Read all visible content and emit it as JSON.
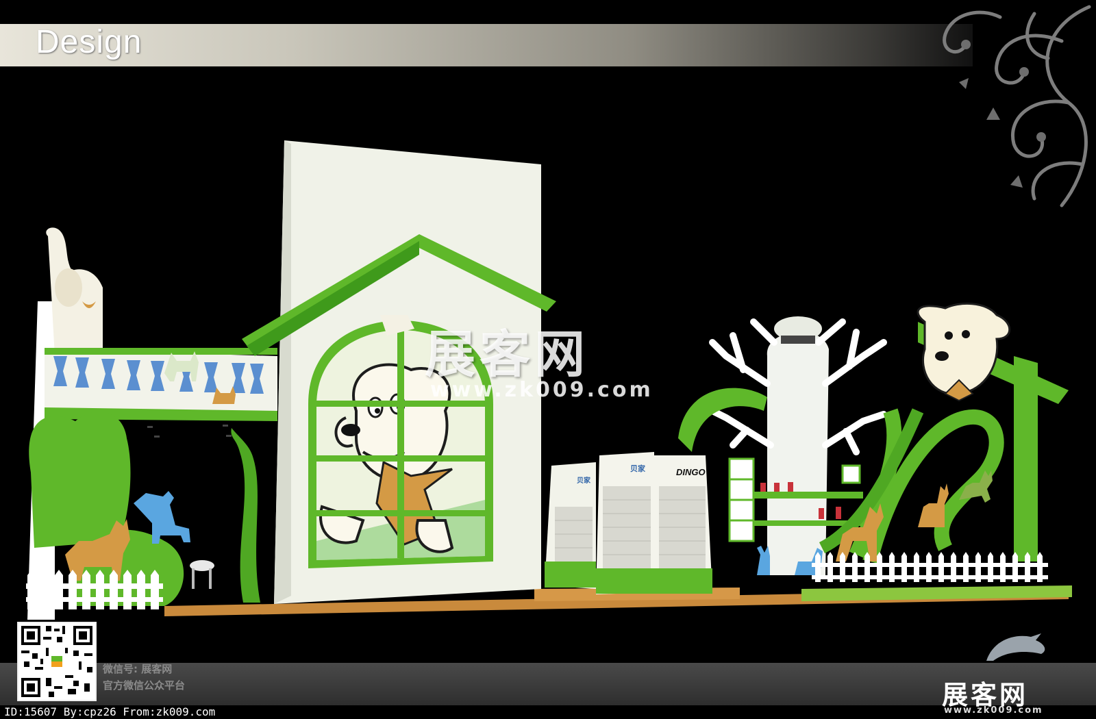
{
  "header": {
    "title": "Design"
  },
  "watermark": {
    "name": "展客网",
    "url": "www.zk009.com"
  },
  "signs": {
    "brand_a": "贝家",
    "brand_b": "DINGO"
  },
  "footer": {
    "wechat_line1": "微信号: 展客网",
    "wechat_line2": "官方微信公众平台",
    "credit": "ID:15607 By:cpz26 From:zk009.com",
    "logo_name": "展客网",
    "logo_url": "www.zk009.com"
  },
  "colors": {
    "green": "#5fb82a",
    "dark_green": "#3f9a1b",
    "wall": "#f0f2e8",
    "bone_blue": "#5b8fd0",
    "dog_tan": "#d49a45",
    "floor": "#c98a3c"
  }
}
